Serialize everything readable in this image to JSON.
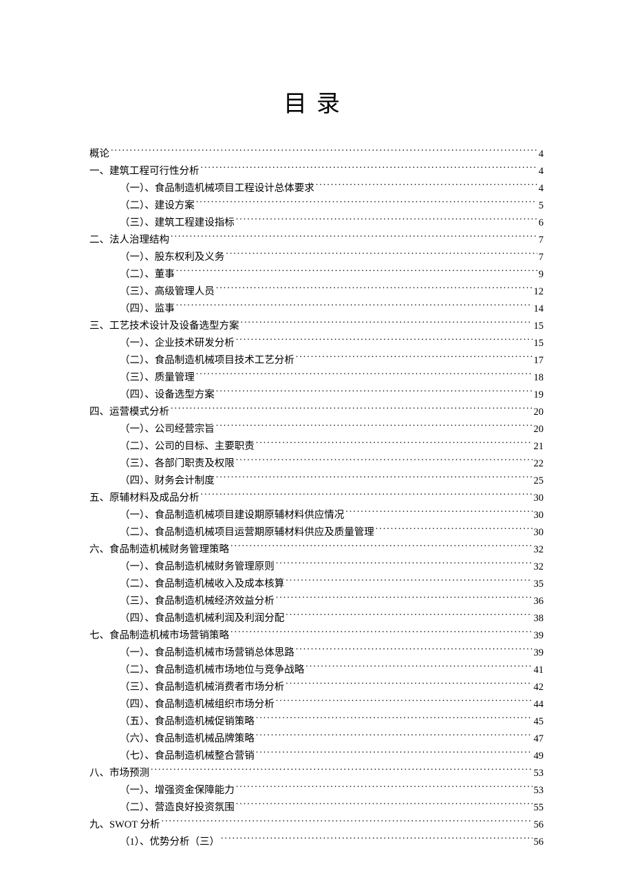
{
  "title": "目录",
  "entries": [
    {
      "level": 0,
      "label": "概论",
      "page": "4"
    },
    {
      "level": 0,
      "label": "一、建筑工程可行性分析",
      "page": "4"
    },
    {
      "level": 1,
      "label": "（一）、食品制造机械项目工程设计总体要求",
      "page": "4"
    },
    {
      "level": 1,
      "label": "（二）、建设方案",
      "page": "5"
    },
    {
      "level": 1,
      "label": "（三）、建筑工程建设指标",
      "page": "6"
    },
    {
      "level": 0,
      "label": "二、法人治理结构",
      "page": "7"
    },
    {
      "level": 1,
      "label": "（一）、股东权利及义务",
      "page": "7"
    },
    {
      "level": 1,
      "label": "（二）、董事",
      "page": "9"
    },
    {
      "level": 1,
      "label": "（三）、高级管理人员",
      "page": "12"
    },
    {
      "level": 1,
      "label": "（四）、监事",
      "page": "14"
    },
    {
      "level": 0,
      "label": "三、工艺技术设计及设备选型方案",
      "page": "15"
    },
    {
      "level": 1,
      "label": "（一）、企业技术研发分析",
      "page": "15"
    },
    {
      "level": 1,
      "label": "（二）、食品制造机械项目技术工艺分析",
      "page": "17"
    },
    {
      "level": 1,
      "label": "（三）、质量管理",
      "page": "18"
    },
    {
      "level": 1,
      "label": "（四）、设备选型方案",
      "page": "19"
    },
    {
      "level": 0,
      "label": "四、运营模式分析",
      "page": "20"
    },
    {
      "level": 1,
      "label": "（一）、公司经营宗旨",
      "page": "20"
    },
    {
      "level": 1,
      "label": "（二）、公司的目标、主要职责",
      "page": "21"
    },
    {
      "level": 1,
      "label": "（三）、各部门职责及权限",
      "page": "22"
    },
    {
      "level": 1,
      "label": "（四）、财务会计制度",
      "page": "25"
    },
    {
      "level": 0,
      "label": "五、原辅材料及成品分析",
      "page": "30"
    },
    {
      "level": 1,
      "label": "（一）、食品制造机械项目建设期原辅材料供应情况",
      "page": "30"
    },
    {
      "level": 1,
      "label": "（二）、食品制造机械项目运营期原辅材料供应及质量管理",
      "page": "30"
    },
    {
      "level": 0,
      "label": "六、食品制造机械财务管理策略",
      "page": "32"
    },
    {
      "level": 1,
      "label": "（一）、食品制造机械财务管理原则",
      "page": "32"
    },
    {
      "level": 1,
      "label": "（二）、食品制造机械收入及成本核算",
      "page": "35"
    },
    {
      "level": 1,
      "label": "（三）、食品制造机械经济效益分析",
      "page": "36"
    },
    {
      "level": 1,
      "label": "（四）、食品制造机械利润及利润分配",
      "page": "38"
    },
    {
      "level": 0,
      "label": "七、食品制造机械市场营销策略",
      "page": "39"
    },
    {
      "level": 1,
      "label": "（一）、食品制造机械市场营销总体思路",
      "page": "39"
    },
    {
      "level": 1,
      "label": "（二）、食品制造机械市场地位与竞争战略",
      "page": "41"
    },
    {
      "level": 1,
      "label": "（三）、食品制造机械消费者市场分析",
      "page": "42"
    },
    {
      "level": 1,
      "label": "（四）、食品制造机械组织市场分析",
      "page": "44"
    },
    {
      "level": 1,
      "label": "（五）、食品制造机械促销策略",
      "page": "45"
    },
    {
      "level": 1,
      "label": "（六）、食品制造机械品牌策略",
      "page": "47"
    },
    {
      "level": 1,
      "label": "（七）、食品制造机械整合营销",
      "page": "49"
    },
    {
      "level": 0,
      "label": "八、市场预测",
      "page": "53"
    },
    {
      "level": 1,
      "label": "（一）、增强资金保障能力",
      "page": "53"
    },
    {
      "level": 1,
      "label": "（二）、营造良好投资氛围",
      "page": "55"
    },
    {
      "level": 0,
      "label": "九、SWOT 分析",
      "page": "56"
    },
    {
      "level": 1,
      "label": "（1）、优势分析（三）",
      "page": "56"
    }
  ]
}
